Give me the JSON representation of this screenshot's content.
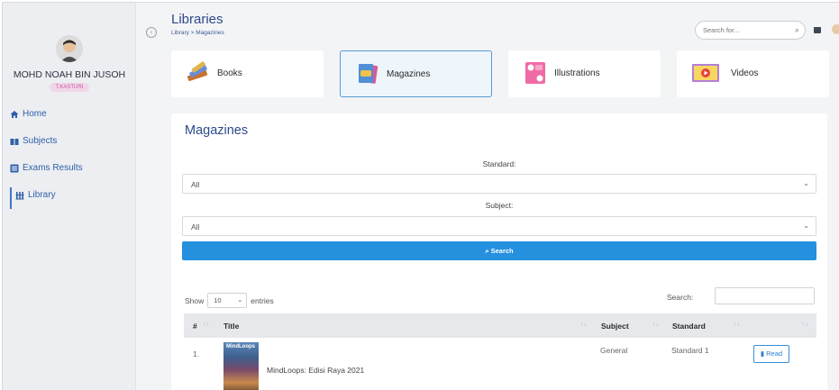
{
  "header": {
    "title": "Libraries",
    "breadcrumb": "Library > Magazines",
    "search_placeholder": "Search for..."
  },
  "sidebar": {
    "user_name": "MOHD NOAH BIN JUSOH",
    "user_badge": "T.KASTURI",
    "items": [
      {
        "label": "Home",
        "icon": "home-icon"
      },
      {
        "label": "Subjects",
        "icon": "book-icon"
      },
      {
        "label": "Exams Results",
        "icon": "list-icon"
      },
      {
        "label": "Library",
        "icon": "library-icon"
      }
    ],
    "active_item": "Library"
  },
  "categories": [
    {
      "label": "Books",
      "icon": "books-icon"
    },
    {
      "label": "Magazines",
      "icon": "magazine-icon"
    },
    {
      "label": "Illustrations",
      "icon": "illustration-icon"
    },
    {
      "label": "Videos",
      "icon": "video-icon"
    }
  ],
  "active_category": "Magazines",
  "panel": {
    "title": "Magazines",
    "standard_label": "Standard:",
    "standard_value": "All",
    "subject_label": "Subject:",
    "subject_value": "All",
    "search_button": "Search",
    "show_label": "Show",
    "entries_value": "10",
    "entries_label": "entries",
    "table_search_label": "Search:"
  },
  "table": {
    "columns": [
      "#",
      "Title",
      "Subject",
      "Standard"
    ],
    "rows": [
      {
        "num": "1.",
        "thumb_text": "MindLoops",
        "title": "MindLoops: Edisi Raya 2021",
        "subject": "General",
        "standard": "Standard 1",
        "action": "Read"
      }
    ]
  },
  "colors": {
    "accent": "#2490de",
    "title": "#2d4a8a",
    "active_border": "#5a9ad6"
  }
}
